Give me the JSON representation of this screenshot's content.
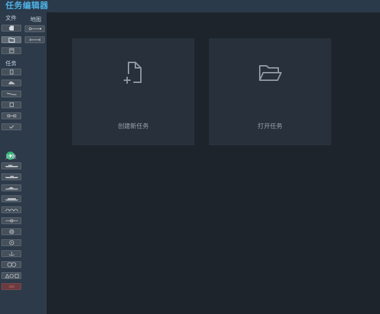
{
  "app": {
    "title": "任务编辑器"
  },
  "sidebar": {
    "file_label": "文件",
    "map_label": "地图",
    "task_label": "任务",
    "object_label": "对象"
  },
  "main": {
    "cards": [
      {
        "label": "创建新任务",
        "icon": "new-file-icon"
      },
      {
        "label": "打开任务",
        "icon": "open-folder-icon"
      }
    ]
  },
  "colors": {
    "accent": "#4fb3e6",
    "background": "#1e242c",
    "sidebar": "#2c3a49",
    "card": "#28313b",
    "status_green": "#2bb673"
  }
}
